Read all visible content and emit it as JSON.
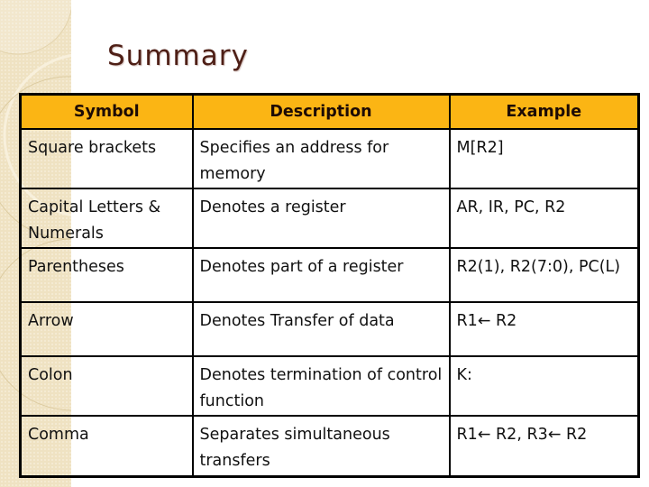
{
  "slide": {
    "title": "Summary"
  },
  "table": {
    "headers": [
      "Symbol",
      "Description",
      "Example"
    ],
    "rows": [
      {
        "symbol": "Square brackets",
        "description": "Specifies an address for memory",
        "example": "M[R2]"
      },
      {
        "symbol": "Capital Letters & Numerals",
        "description": "Denotes a register",
        "example": "AR, IR, PC, R2"
      },
      {
        "symbol": "Parentheses",
        "description": "Denotes part of a register",
        "example": "R2(1), R2(7:0), PC(L)"
      },
      {
        "symbol": "Arrow",
        "description": "Denotes Transfer of data",
        "example": "R1← R2"
      },
      {
        "symbol": "Colon",
        "description": "Denotes termination of control function",
        "example": "K:"
      },
      {
        "symbol": "Comma",
        "description": "Separates simultaneous transfers",
        "example": "R1← R2, R3← R2"
      }
    ]
  },
  "colors": {
    "header_bg": "#fbb514",
    "title": "#4e1f16",
    "stripe": "#efe2c2"
  }
}
